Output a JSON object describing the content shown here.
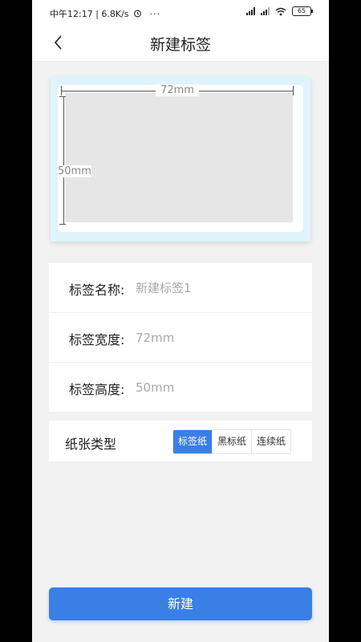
{
  "status_bar": {
    "time_text": "中午12:17 | 6.8K/s",
    "more_dots": "···",
    "battery": "65"
  },
  "header": {
    "title": "新建标签"
  },
  "preview": {
    "width_label": "72mm",
    "height_label": "50mm"
  },
  "form": {
    "name_label": "标签名称:",
    "name_placeholder": "新建标签1",
    "width_label": "标签宽度:",
    "width_placeholder": "72mm",
    "height_label": "标签高度:",
    "height_placeholder": "50mm"
  },
  "paper_type": {
    "label": "纸张类型",
    "options": [
      "标签纸",
      "黑标纸",
      "连续纸"
    ],
    "selected": "标签纸"
  },
  "create_button": "新建",
  "colors": {
    "accent": "#3a7fe6",
    "preview_bg": "#dff4fa",
    "page_bg": "#f2f2f2"
  }
}
